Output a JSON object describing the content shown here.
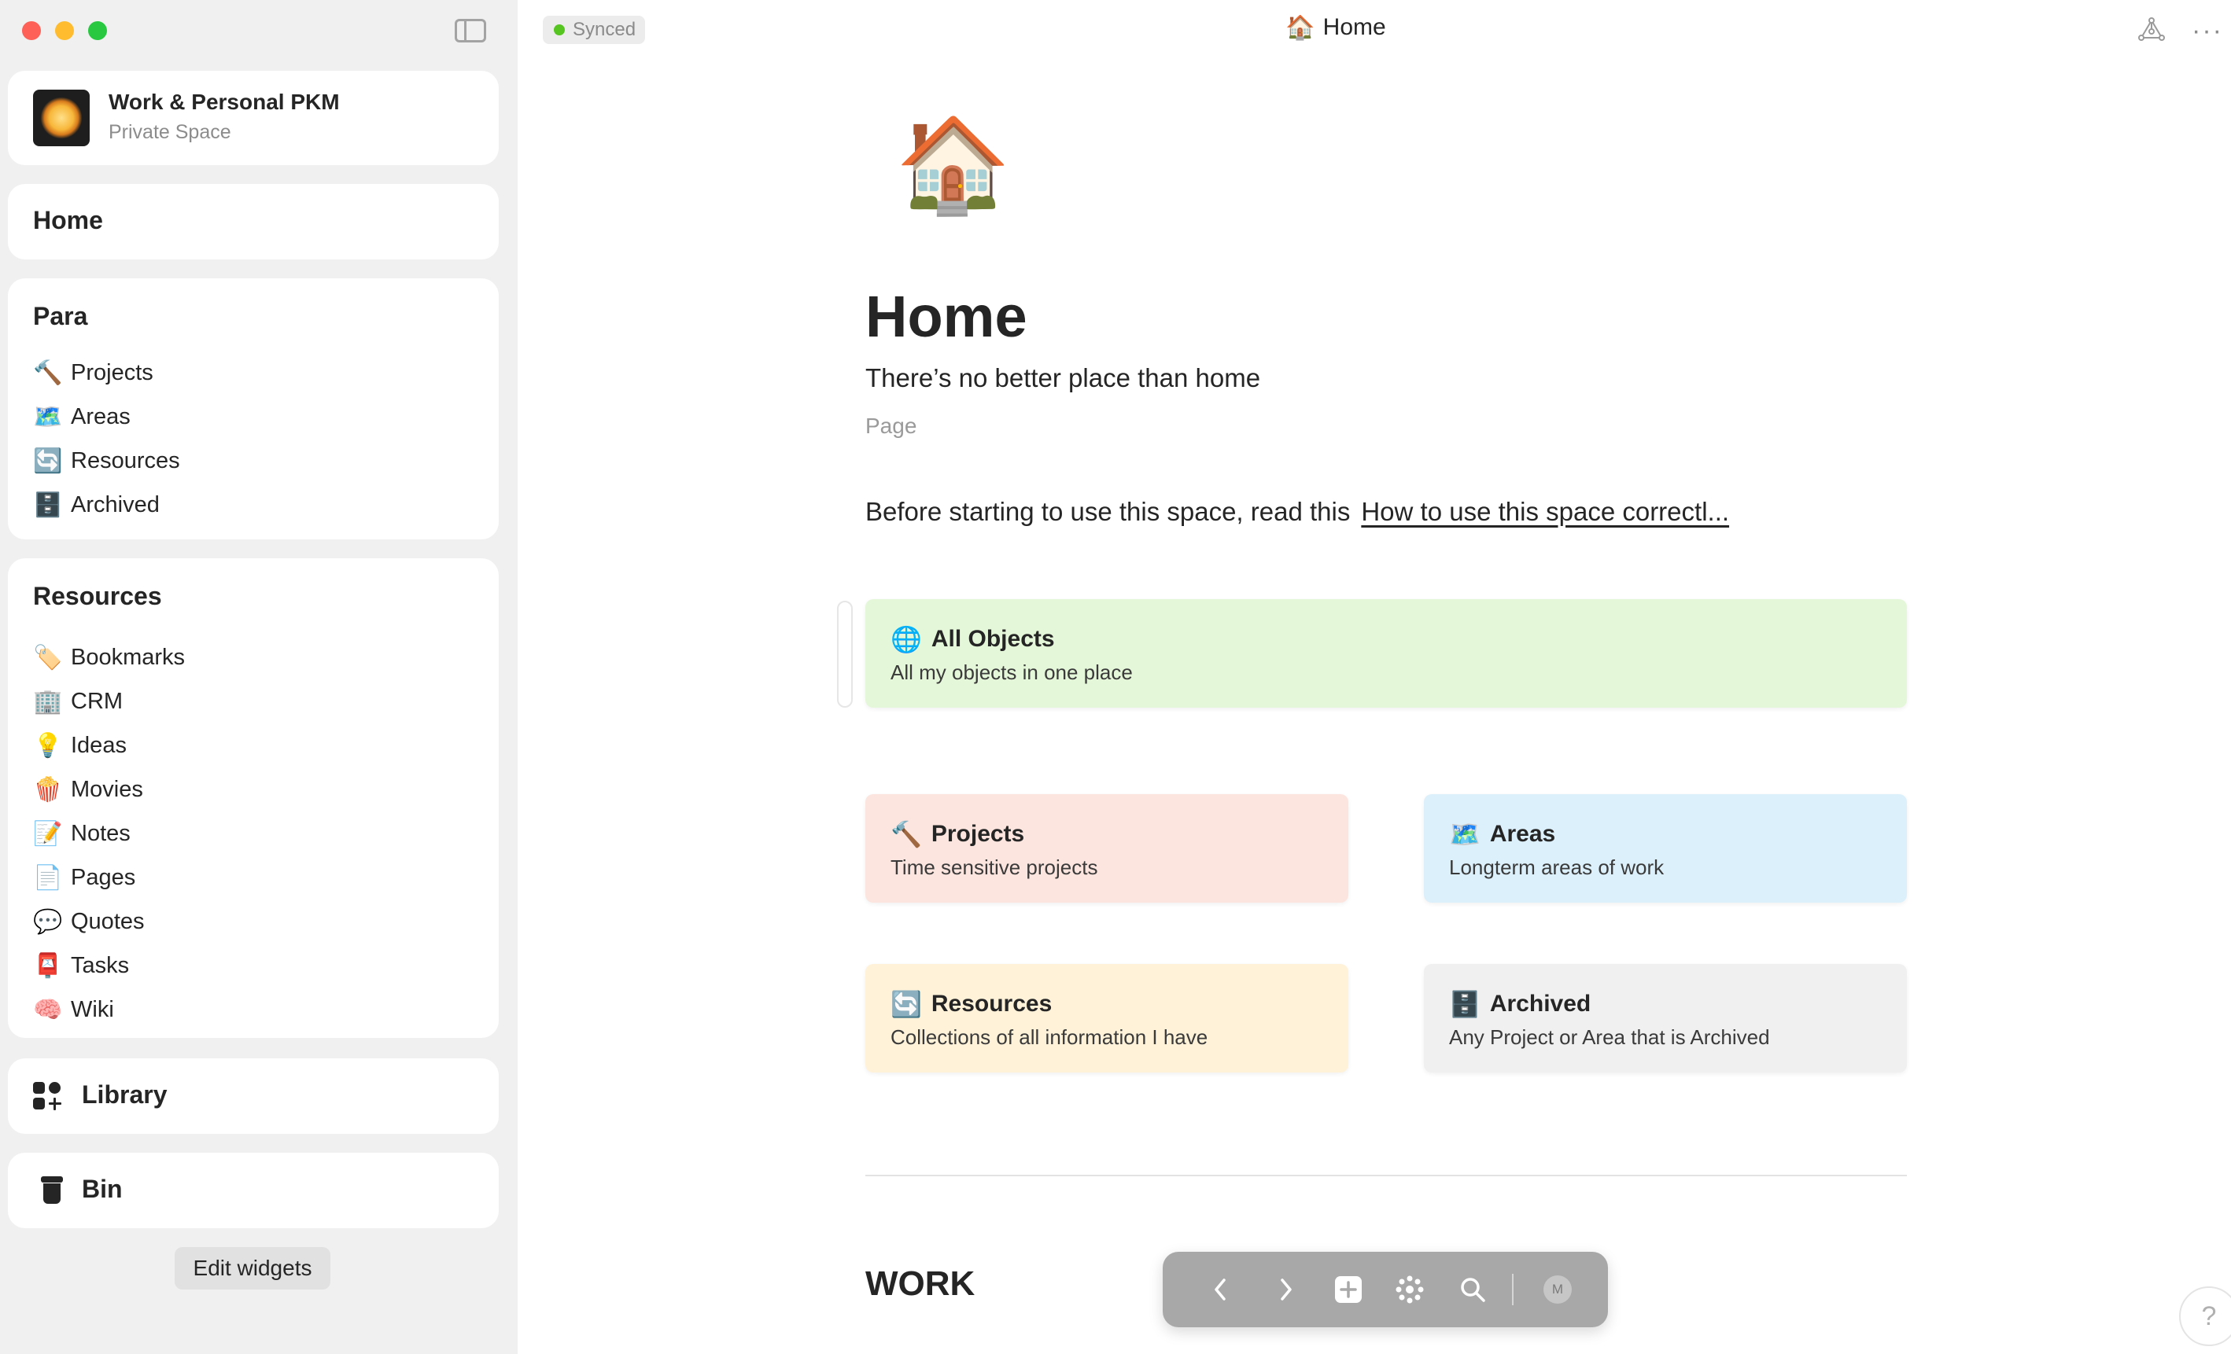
{
  "sidebar": {
    "space": {
      "name": "Work & Personal PKM",
      "subtitle": "Private Space"
    },
    "home_label": "Home",
    "para": {
      "title": "Para",
      "items": [
        {
          "emoji": "🔨",
          "label": "Projects"
        },
        {
          "emoji": "🗺️",
          "label": "Areas"
        },
        {
          "emoji": "🔄",
          "label": "Resources"
        },
        {
          "emoji": "🗄️",
          "label": "Archived"
        }
      ]
    },
    "resources": {
      "title": "Resources",
      "items": [
        {
          "emoji": "🏷️",
          "label": "Bookmarks"
        },
        {
          "emoji": "🏢",
          "label": "CRM"
        },
        {
          "emoji": "💡",
          "label": "Ideas"
        },
        {
          "emoji": "🍿",
          "label": "Movies"
        },
        {
          "emoji": "📝",
          "label": "Notes"
        },
        {
          "emoji": "📄",
          "label": "Pages"
        },
        {
          "emoji": "💬",
          "label": "Quotes"
        },
        {
          "emoji": "📮",
          "label": "Tasks"
        },
        {
          "emoji": "🧠",
          "label": "Wiki"
        }
      ]
    },
    "library_label": "Library",
    "bin_label": "Bin",
    "edit_widgets_label": "Edit widgets"
  },
  "topbar": {
    "sync_status": "Synced",
    "title_emoji": "🏠",
    "title": "Home",
    "more": "···"
  },
  "page": {
    "emoji": "🏠",
    "title": "Home",
    "description": "There’s no better place than home",
    "type": "Page",
    "intro_text": "Before starting to use this space, read this",
    "intro_link": "How to use this space correctl...",
    "cards": [
      {
        "emoji": "🌐",
        "title": "All Objects",
        "desc": "All my objects in one place",
        "color": "#e5f7d9"
      },
      {
        "emoji": "🔨",
        "title": "Projects",
        "desc": "Time sensitive projects",
        "color": "#fde5df"
      },
      {
        "emoji": "🗺️",
        "title": "Areas",
        "desc": "Longterm areas of work",
        "color": "#dcf0fb"
      },
      {
        "emoji": "🔄",
        "title": "Resources",
        "desc": "Collections of all information I have",
        "color": "#fff2d9"
      },
      {
        "emoji": "🗄️",
        "title": "Archived",
        "desc": "Any Project or Area that is Archived",
        "color": "#f0f0f0"
      }
    ],
    "section_heading": "WORK"
  },
  "bottom_nav": {
    "avatar_initial": "M",
    "icons": [
      "back-icon",
      "forward-icon",
      "add-icon",
      "graph-icon",
      "search-icon"
    ]
  },
  "help_label": "?",
  "colors": {
    "sync_dot": "#57c521",
    "sidebar_bg": "#f0f0f0",
    "nav_pill": "#a8a8a8"
  }
}
